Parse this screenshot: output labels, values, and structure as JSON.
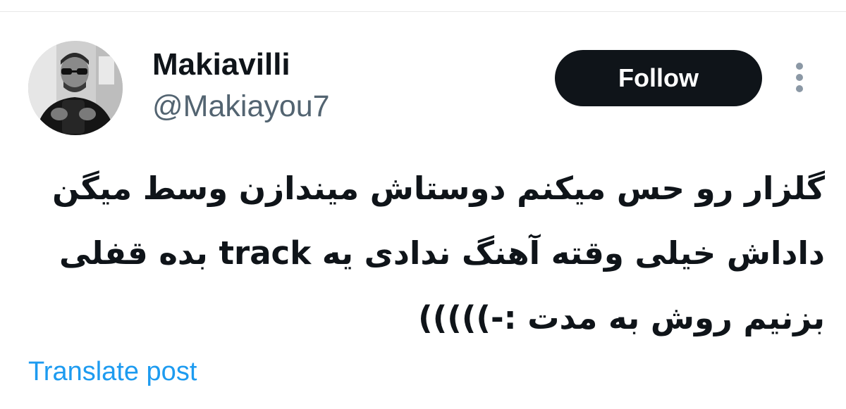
{
  "user": {
    "display_name": "Makiavilli",
    "handle": "@Makiayou7"
  },
  "actions": {
    "follow_label": "Follow",
    "more_icon": "more-vertical-icon"
  },
  "tweet": {
    "lines": [
      "گلزار رو حس میکنم دوستاش میندازن وسط میگن",
      "داداش خیلی وقته آهنگ ندادی یه track بده قفلی",
      "بزنیم روش به مدت :-)))))"
    ]
  },
  "footer": {
    "translate_label": "Translate post"
  },
  "colors": {
    "follow_bg": "#0f1419",
    "handle": "#536471",
    "link": "#1d9bf0"
  }
}
